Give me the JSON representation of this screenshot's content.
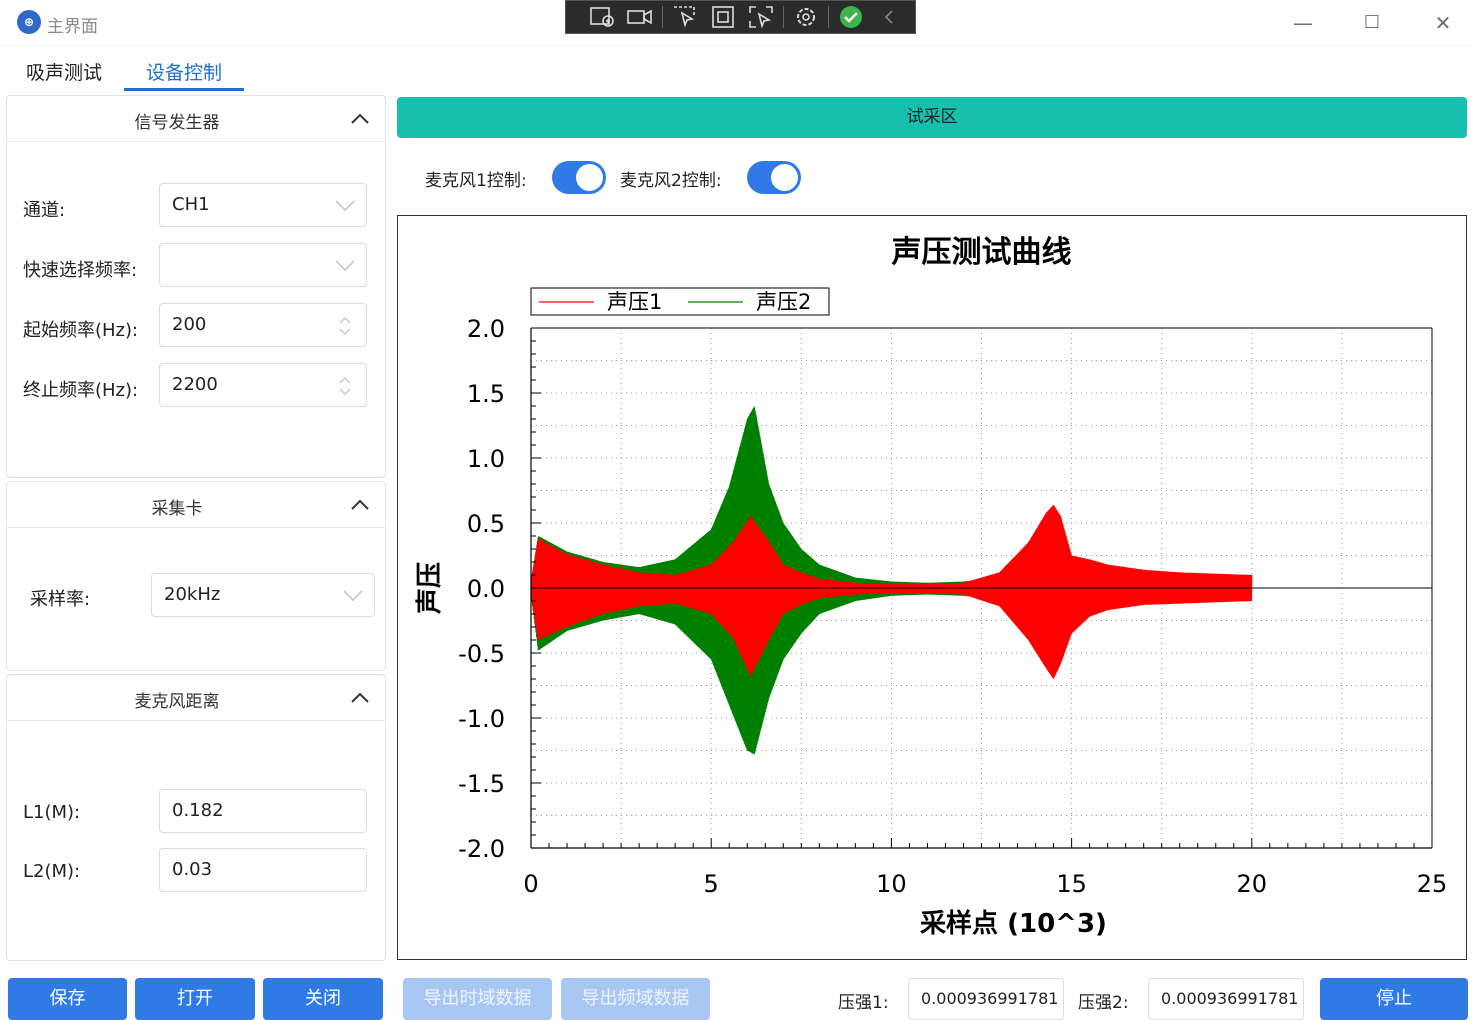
{
  "window": {
    "title": "主界面",
    "minimize_glyph": "—",
    "maximize_glyph": "☐",
    "close_glyph": "✕"
  },
  "tabs": [
    {
      "label": "吸声测试",
      "active": false
    },
    {
      "label": "设备控制",
      "active": true
    }
  ],
  "signal_generator": {
    "title": "信号发生器",
    "channel_label": "通道:",
    "channel_value": "CH1",
    "quick_freq_label": "快速选择频率:",
    "quick_freq_value": "",
    "start_freq_label": "起始频率(Hz):",
    "start_freq_value": "200",
    "end_freq_label": "终止频率(Hz):",
    "end_freq_value": "2200"
  },
  "acquisition_card": {
    "title": "采集卡",
    "sample_rate_label": "采样率:",
    "sample_rate_value": "20kHz"
  },
  "mic_distance": {
    "title": "麦克风距离",
    "l1_label": "L1(M):",
    "l1_value": "0.182",
    "l2_label": "L2(M):",
    "l2_value": "0.03"
  },
  "left_buttons": {
    "save": "保存",
    "open": "打开",
    "close": "关闭"
  },
  "sampling_area": {
    "title": "试采区",
    "mic1_label": "麦克风1控制:",
    "mic1_on": true,
    "mic2_label": "麦克风2控制:",
    "mic2_on": true
  },
  "bottom_bar": {
    "export_time": "导出时域数据",
    "export_freq": "导出频域数据",
    "pressure1_label": "压强1:",
    "pressure1_value": "0.000936991781",
    "pressure2_label": "压强2:",
    "pressure2_value": "0.000936991781",
    "stop": "停止"
  },
  "colors": {
    "accent": "#2f7ae5",
    "header_teal": "#17bfae",
    "series1": "#ff0000",
    "series2": "#008000"
  },
  "chart_data": {
    "type": "line",
    "title": "声压测试曲线",
    "xlabel": "采样点 (10^3)",
    "ylabel": "声压",
    "xlim": [
      0,
      25
    ],
    "ylim": [
      -2.0,
      2.0
    ],
    "xticks": [
      "0",
      "5",
      "10",
      "15",
      "20",
      "25"
    ],
    "yticks": [
      "2.0",
      "1.5",
      "1.0",
      "0.5",
      "0.0",
      "-0.5",
      "-1.0",
      "-1.5",
      "-2.0"
    ],
    "grid": true,
    "legend_position": "top-left",
    "series": [
      {
        "name": "声压1",
        "color": "#ff0000",
        "envelope": {
          "x": [
            0,
            0.2,
            1,
            2,
            3,
            4,
            5,
            5.6,
            6.1,
            6.6,
            7,
            7.5,
            8,
            9,
            10,
            11,
            12,
            13,
            13.8,
            14.3,
            14.5,
            14.7,
            15,
            15.5,
            16,
            17,
            18,
            19,
            20
          ],
          "upper": [
            0.05,
            0.38,
            0.26,
            0.18,
            0.12,
            0.1,
            0.18,
            0.35,
            0.55,
            0.36,
            0.18,
            0.12,
            0.07,
            0.04,
            0.03,
            0.03,
            0.04,
            0.12,
            0.35,
            0.58,
            0.64,
            0.55,
            0.25,
            0.22,
            0.18,
            0.14,
            0.12,
            0.11,
            0.1
          ],
          "lower": [
            -0.05,
            -0.4,
            -0.3,
            -0.2,
            -0.14,
            -0.12,
            -0.2,
            -0.38,
            -0.68,
            -0.4,
            -0.2,
            -0.13,
            -0.08,
            -0.05,
            -0.04,
            -0.04,
            -0.05,
            -0.14,
            -0.4,
            -0.62,
            -0.7,
            -0.58,
            -0.35,
            -0.22,
            -0.17,
            -0.13,
            -0.12,
            -0.11,
            -0.1
          ]
        }
      },
      {
        "name": "声压2",
        "color": "#008000",
        "envelope": {
          "x": [
            0,
            0.2,
            1,
            2,
            3,
            4,
            5,
            5.5,
            6.0,
            6.2,
            6.6,
            7,
            7.5,
            8,
            9,
            10,
            11,
            12,
            13,
            14,
            15,
            16,
            17,
            18,
            19,
            20
          ],
          "upper": [
            0.05,
            0.4,
            0.28,
            0.2,
            0.16,
            0.22,
            0.45,
            0.78,
            1.3,
            1.4,
            0.8,
            0.5,
            0.3,
            0.18,
            0.08,
            0.05,
            0.04,
            0.05,
            0.08,
            0.1,
            0.12,
            0.11,
            0.1,
            0.1,
            0.09,
            0.09
          ],
          "lower": [
            -0.05,
            -0.48,
            -0.33,
            -0.25,
            -0.2,
            -0.28,
            -0.55,
            -0.9,
            -1.25,
            -1.28,
            -0.85,
            -0.55,
            -0.35,
            -0.2,
            -0.1,
            -0.06,
            -0.05,
            -0.06,
            -0.09,
            -0.11,
            -0.13,
            -0.12,
            -0.11,
            -0.1,
            -0.1,
            -0.09
          ]
        }
      }
    ]
  }
}
